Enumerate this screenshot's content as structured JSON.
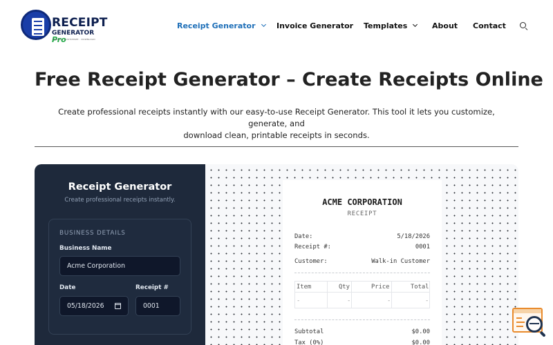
{
  "brand": {
    "name": "RECEIPT",
    "sub": "GENERATOR",
    "pro": "Pro",
    "tagline": "CREATE · CUSTOMIZE · DOWNLOAD"
  },
  "nav": {
    "items": [
      {
        "label": "Receipt Generator",
        "active": true,
        "dropdown": true
      },
      {
        "label": "Invoice Generator",
        "active": false,
        "dropdown": false
      },
      {
        "label": "Templates",
        "active": false,
        "dropdown": true
      },
      {
        "label": "About",
        "active": false,
        "dropdown": false
      },
      {
        "label": "Contact",
        "active": false,
        "dropdown": false
      }
    ],
    "search_icon": "search-icon"
  },
  "hero": {
    "title": "Free Receipt Generator – Create Receipts Online",
    "intro_line1": "Create professional receipts instantly with our easy-to-use Receipt Generator. This tool it lets you customize, generate, and",
    "intro_line2": "download clean, printable receipts in seconds."
  },
  "generator": {
    "title": "Receipt Generator",
    "subtitle": "Create professional receipts instantly.",
    "section_label": "BUSINESS DETAILS",
    "business_name_label": "Business Name",
    "business_name_value": "Acme Corporation",
    "date_label": "Date",
    "date_value": "05/18/2026",
    "receipt_no_label": "Receipt #",
    "receipt_no_value": "0001"
  },
  "receipt": {
    "business": "ACME CORPORATION",
    "heading": "RECEIPT",
    "date_label": "Date:",
    "date_value": "5/18/2026",
    "number_label": "Receipt #:",
    "number_value": "0001",
    "customer_label": "Customer:",
    "customer_value": "Walk-in Customer",
    "columns": [
      "Item",
      "Qty",
      "Price",
      "Total"
    ],
    "rows": [
      [
        "-",
        "-",
        "-",
        "-"
      ]
    ],
    "subtotal_label": "Subtotal",
    "subtotal_value": "$0.00",
    "tax_label": "Tax (0%)",
    "tax_value": "$0.00"
  },
  "colors": {
    "accent": "#1e6fb8",
    "panel_bg": "#1e293b",
    "widget": "#e98a2b"
  }
}
